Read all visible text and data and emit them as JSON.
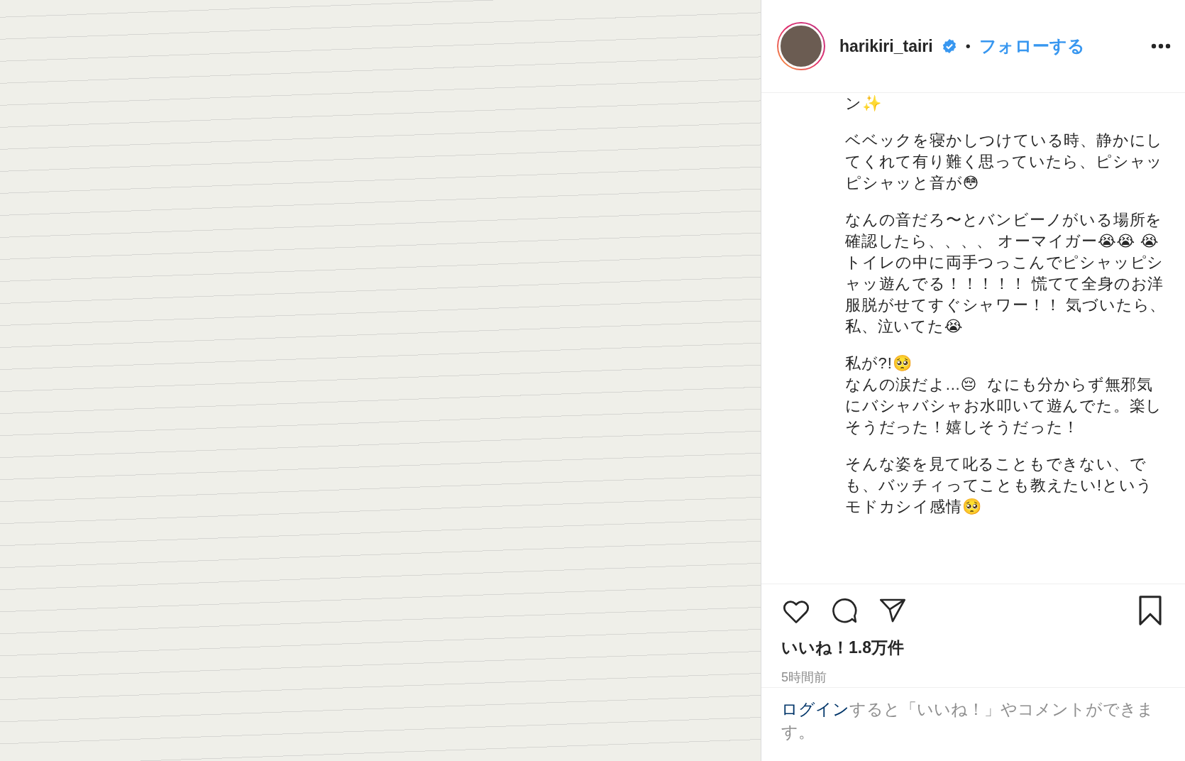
{
  "post": {
    "photo": {
      "kind": "photo"
    }
  },
  "header": {
    "username": "harikiri_tairi",
    "verified": true,
    "separator": "•",
    "follow": "フォローする"
  },
  "caption": {
    "paragraphs": [
      "ン✨",
      "ベベックを寝かしつけている時、静かにしてくれて有り難く思っていたら、ピシャッピシャッと音が😳",
      "なんの音だろ〜とバンビーノがいる場所を確認したら、、、、 オーマイガー😭😭 😭 トイレの中に両手つっこんでピシャッピシャッ遊んでる！！！！！ 慌てて全身のお洋服脱がせてすぐシャワー！！ 気づいたら、私、泣いてた😭",
      "私が?!🥺\nなんの涙だよ...😔  なにも分からず無邪気にバシャバシャお水叩いて遊んでた。楽しそうだった！嬉しそうだった！",
      "そんな姿を見て叱ることもできない、でも、バッチィってことも教えたい!というモドカシイ感情🥺"
    ]
  },
  "actions": {
    "liked": false,
    "saved": false
  },
  "likes": "いいね！1.8万件",
  "time": "5時間前",
  "login_prompt": {
    "link": "ログイン",
    "text": "すると「いいね！」やコメントができます。"
  }
}
